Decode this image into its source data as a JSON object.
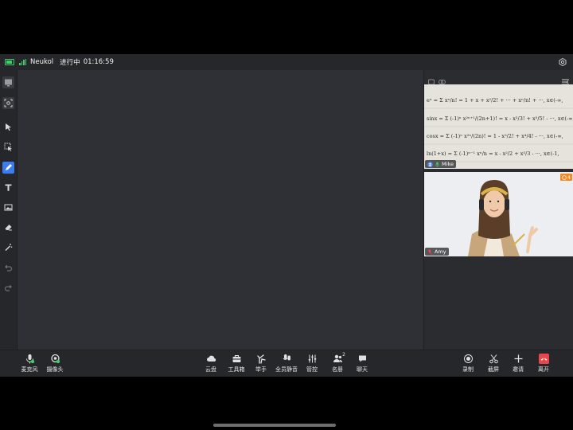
{
  "status": {
    "app_name": "Neukol",
    "meeting_status": "进行中",
    "timer": "01:16:59"
  },
  "colors": {
    "accent": "#3b7cf0",
    "battery": "#3fcf6a",
    "leave": "#e8464b",
    "badge": "#f08a24"
  },
  "left_toolbar": {
    "items": [
      {
        "icon": "whiteboard-icon"
      },
      {
        "icon": "screenshot-icon"
      },
      {
        "icon": "pointer-icon"
      },
      {
        "icon": "select-icon"
      },
      {
        "icon": "pen-icon",
        "active": true
      },
      {
        "icon": "text-icon"
      },
      {
        "icon": "image-icon"
      },
      {
        "icon": "eraser-icon"
      },
      {
        "icon": "magic-wand-icon"
      },
      {
        "icon": "undo-icon"
      },
      {
        "icon": "redo-icon"
      }
    ]
  },
  "videos": {
    "first": {
      "name": "Mike",
      "math_lines": [
        "eˣ = Σ xⁿ/n! = 1 + x + x²/2! + ··· + xⁿ/n! + ···, x∈(-∞,",
        "sinx = Σ (-1)ⁿ x²ⁿ⁺¹/(2n+1)! = x - x³/3! + x⁵/5! - ···, x∈(-∞,",
        "cosx = Σ (-1)ⁿ x²ⁿ/(2n)! = 1 - x²/2! + x⁴/4! - ···, x∈(-∞,",
        "ln(1+x) = Σ (-1)ⁿ⁻¹ xⁿ/n = x - x²/2 + x³/3 - ···, x∈(-1,"
      ]
    },
    "second": {
      "name": "Amy",
      "badge": "4"
    }
  },
  "bottom_bar": {
    "left": [
      {
        "label": "麦克风",
        "icon": "microphone-icon"
      },
      {
        "label": "摄像头",
        "icon": "camera-icon"
      }
    ],
    "center": [
      {
        "label": "云盘",
        "icon": "cloud-icon"
      },
      {
        "label": "工具箱",
        "icon": "toolbox-icon"
      },
      {
        "label": "举手",
        "icon": "raise-hand-icon"
      },
      {
        "label": "全员静音",
        "icon": "mute-all-icon"
      },
      {
        "label": "管控",
        "icon": "controls-icon"
      },
      {
        "label": "名册",
        "icon": "roster-icon",
        "count": "2"
      },
      {
        "label": "聊天",
        "icon": "chat-icon"
      }
    ],
    "right": [
      {
        "label": "录制",
        "icon": "record-icon"
      },
      {
        "label": "截屏",
        "icon": "scissors-icon"
      },
      {
        "label": "邀请",
        "icon": "plus-icon"
      },
      {
        "label": "离开",
        "icon": "leave-icon"
      }
    ]
  }
}
